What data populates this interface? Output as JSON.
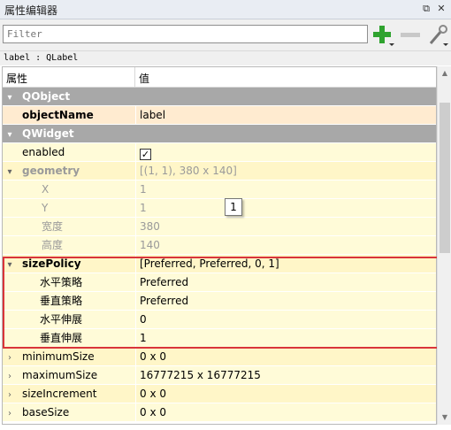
{
  "window": {
    "title": "属性编辑器"
  },
  "filter": {
    "placeholder": "Filter"
  },
  "object_line": "label : QLabel",
  "columns": {
    "property": "属性",
    "value": "值"
  },
  "tooltip_text": "1",
  "rows": [
    {
      "label": "QObject"
    },
    {
      "label": "objectName",
      "value": "label"
    },
    {
      "label": "QWidget"
    },
    {
      "label": "enabled",
      "value": "✓"
    },
    {
      "label": "geometry",
      "value": "[(1, 1), 380 x 140]"
    },
    {
      "label": "X",
      "value": "1"
    },
    {
      "label": "Y",
      "value": "1"
    },
    {
      "label": "宽度",
      "value": "380"
    },
    {
      "label": "高度",
      "value": "140"
    },
    {
      "label": "sizePolicy",
      "value": "[Preferred, Preferred, 0, 1]"
    },
    {
      "label": "水平策略",
      "value": "Preferred"
    },
    {
      "label": "垂直策略",
      "value": "Preferred"
    },
    {
      "label": "水平伸展",
      "value": "0"
    },
    {
      "label": "垂直伸展",
      "value": "1"
    },
    {
      "label": "minimumSize",
      "value": "0 x 0"
    },
    {
      "label": "maximumSize",
      "value": "16777215 x 16777215"
    },
    {
      "label": "sizeIncrement",
      "value": "0 x 0"
    },
    {
      "label": "baseSize",
      "value": "0 x 0"
    }
  ],
  "icons": {
    "float": "float-window-icon",
    "close": "close-icon",
    "add": "plus-icon",
    "remove": "minus-icon",
    "configure": "wrench-icon"
  },
  "colors": {
    "highlight": "#d9343a",
    "category": "#a8a8a8",
    "add_green": "#2fa32f"
  }
}
